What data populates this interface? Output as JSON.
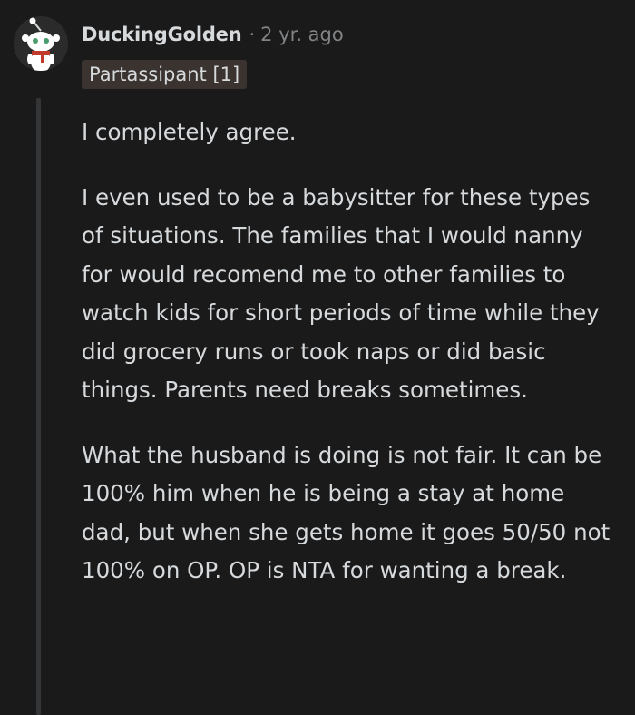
{
  "comment": {
    "username": "DuckingGolden",
    "separator": "·",
    "timestamp": "2 yr. ago",
    "flair": "Partassipant [1]",
    "paragraphs": [
      "I completely agree.",
      "I even used to be a babysitter for these types of situations. The families that I would nanny for would recomend me to other families to watch kids for short periods of time while they did grocery runs or took naps or did basic things. Parents need breaks sometimes.",
      "What the husband is doing is not fair. It can be 100% him when he is being a stay at home dad, but when she gets home it goes 50/50 not 100% on OP. OP is NTA for wanting a break."
    ]
  },
  "colors": {
    "background": "#1a1a1b",
    "text": "#d7dadc",
    "meta": "#818384",
    "flair_bg": "#3a3330",
    "thread_line": "#343536"
  },
  "icons": {
    "avatar": "snoo-avatar-icon"
  }
}
